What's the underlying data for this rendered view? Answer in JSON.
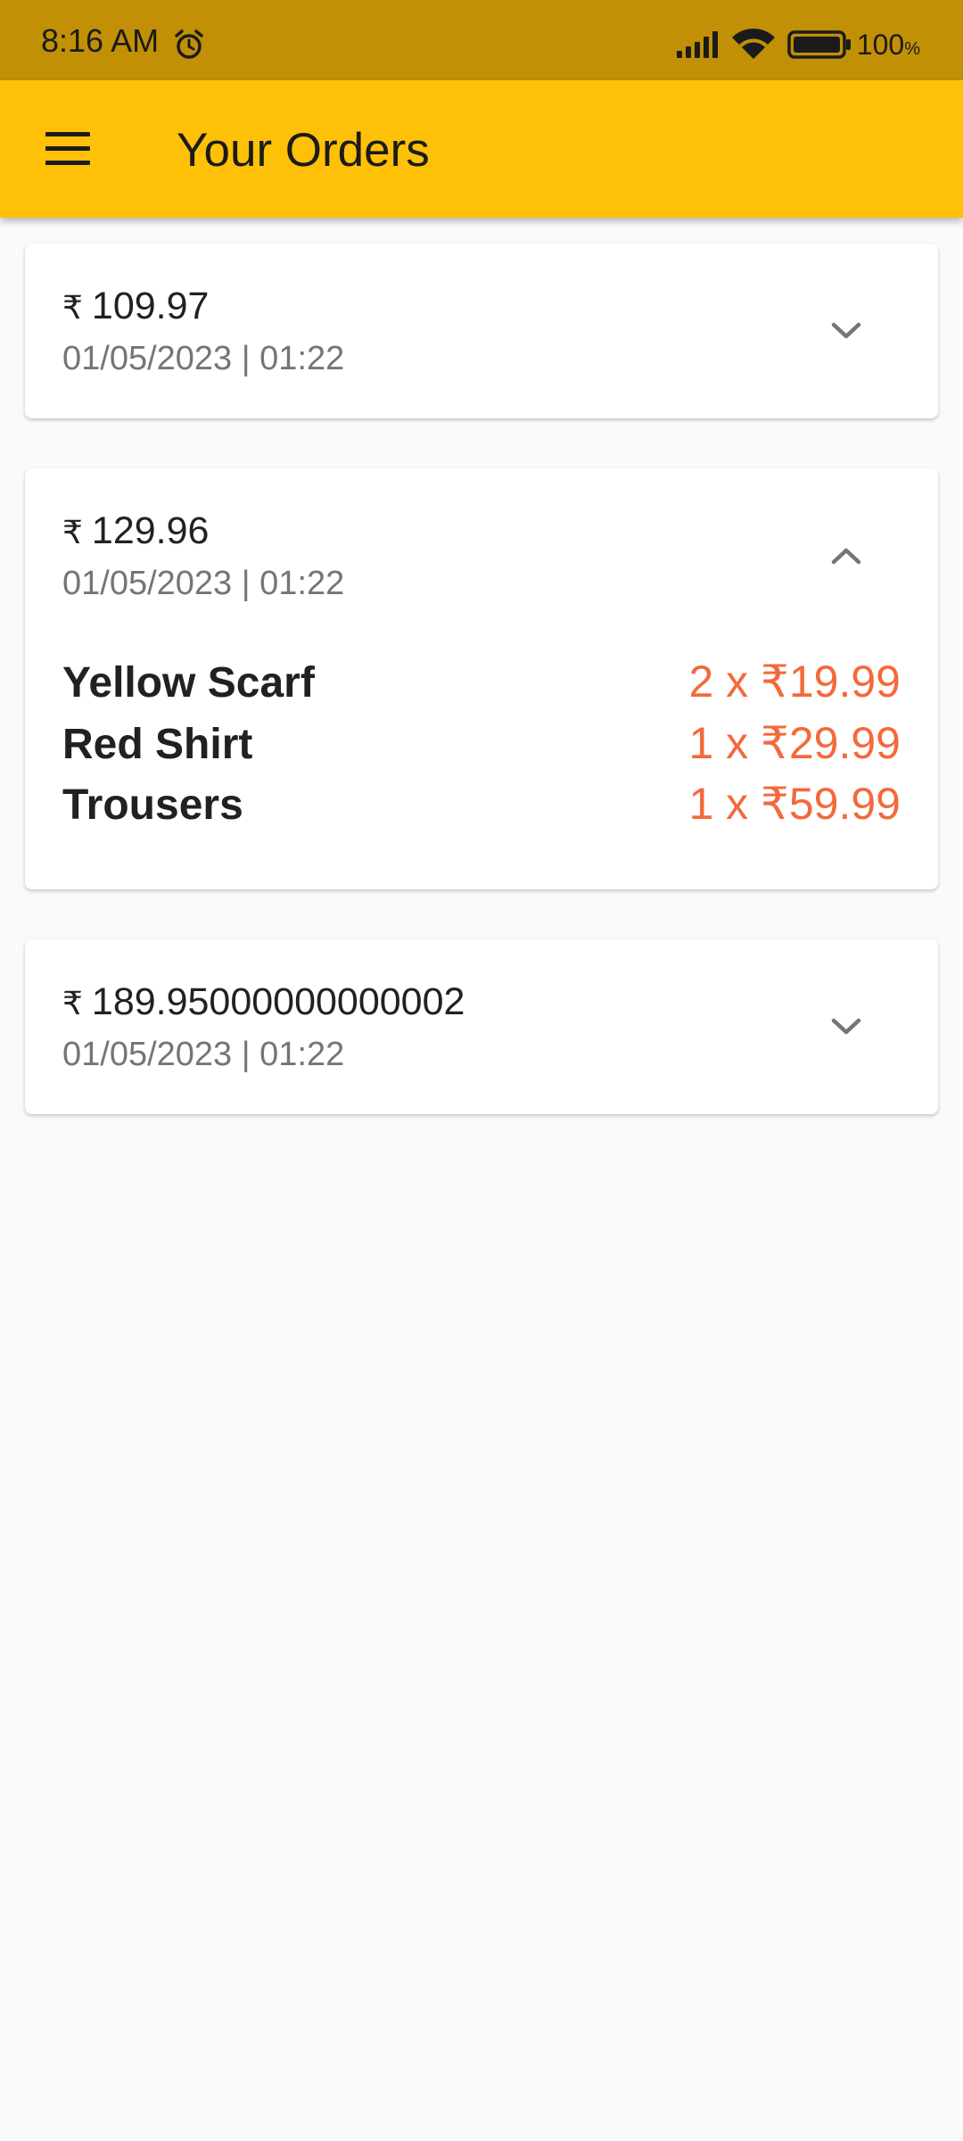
{
  "status_bar": {
    "time": "8:16 AM",
    "battery": "100",
    "battery_unit": "%",
    "icons": [
      "alarm-icon",
      "signal-icon",
      "wifi-icon",
      "battery-icon"
    ]
  },
  "app_bar": {
    "title": "Your Orders",
    "menu_icon": "menu-icon"
  },
  "colors": {
    "status_bar": "#c19004",
    "app_bar": "#ffc107",
    "item_price": "#f4693b",
    "date_text": "#757575",
    "background": "#fafafa"
  },
  "orders": [
    {
      "currency": "₹",
      "amount": "109.97",
      "datetime": "01/05/2023 | 01:22",
      "expanded": false,
      "chevron": "chevron-down-icon"
    },
    {
      "currency": "₹",
      "amount": "129.96",
      "datetime": "01/05/2023 | 01:22",
      "expanded": true,
      "chevron": "chevron-up-icon",
      "items": [
        {
          "name": "Yellow Scarf",
          "price": "2 x ₹19.99"
        },
        {
          "name": "Red Shirt",
          "price": "1 x ₹29.99"
        },
        {
          "name": "Trousers",
          "price": "1 x ₹59.99"
        }
      ]
    },
    {
      "currency": "₹",
      "amount": "189.95000000000002",
      "datetime": "01/05/2023 | 01:22",
      "expanded": false,
      "chevron": "chevron-down-icon"
    }
  ]
}
